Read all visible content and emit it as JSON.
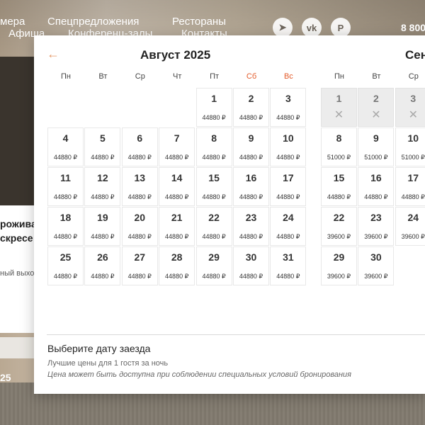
{
  "nav": {
    "links_row1": [
      "мера",
      "Спецпредложения",
      "Рестораны"
    ],
    "links_row2": [
      "Афиша",
      "Конференц-залы",
      "Контакты"
    ],
    "social": [
      {
        "icon": "telegram-icon",
        "glyph": "➤"
      },
      {
        "icon": "vk-icon",
        "glyph": "vk"
      },
      {
        "icon": "pinterest-icon",
        "glyph": "P"
      }
    ],
    "phone": "8 800"
  },
  "left_card": {
    "title_line1": "роживa",
    "title_line2": "скресе",
    "subtitle": "ный выход",
    "year": "25"
  },
  "picker": {
    "prev_icon": "arrow-left-icon",
    "weekdays": [
      "Пн",
      "Вт",
      "Ср",
      "Чт",
      "Пт",
      "Сб",
      "Вс"
    ],
    "month1": {
      "title": "Август 2025",
      "days": [
        {
          "d": "1",
          "p": "44880 ₽"
        },
        {
          "d": "2",
          "p": "44880 ₽"
        },
        {
          "d": "3",
          "p": "44880 ₽"
        },
        {
          "d": "4",
          "p": "44880 ₽"
        },
        {
          "d": "5",
          "p": "44880 ₽"
        },
        {
          "d": "6",
          "p": "44880 ₽"
        },
        {
          "d": "7",
          "p": "44880 ₽"
        },
        {
          "d": "8",
          "p": "44880 ₽"
        },
        {
          "d": "9",
          "p": "44880 ₽"
        },
        {
          "d": "10",
          "p": "44880 ₽"
        },
        {
          "d": "11",
          "p": "44880 ₽"
        },
        {
          "d": "12",
          "p": "44880 ₽"
        },
        {
          "d": "13",
          "p": "44880 ₽"
        },
        {
          "d": "14",
          "p": "44880 ₽"
        },
        {
          "d": "15",
          "p": "44880 ₽"
        },
        {
          "d": "16",
          "p": "44880 ₽"
        },
        {
          "d": "17",
          "p": "44880 ₽"
        },
        {
          "d": "18",
          "p": "44880 ₽"
        },
        {
          "d": "19",
          "p": "44880 ₽"
        },
        {
          "d": "20",
          "p": "44880 ₽"
        },
        {
          "d": "21",
          "p": "44880 ₽"
        },
        {
          "d": "22",
          "p": "44880 ₽"
        },
        {
          "d": "23",
          "p": "44880 ₽"
        },
        {
          "d": "24",
          "p": "44880 ₽"
        },
        {
          "d": "25",
          "p": "44880 ₽"
        },
        {
          "d": "26",
          "p": "44880 ₽"
        },
        {
          "d": "27",
          "p": "44880 ₽"
        },
        {
          "d": "28",
          "p": "44880 ₽"
        },
        {
          "d": "29",
          "p": "44880 ₽"
        },
        {
          "d": "30",
          "p": "44880 ₽"
        },
        {
          "d": "31",
          "p": "44880 ₽"
        }
      ]
    },
    "month2": {
      "title": "Сен",
      "weekdays": [
        "Пн",
        "Вт",
        "Ср"
      ],
      "days": [
        {
          "d": "1",
          "p": "",
          "disabled": true
        },
        {
          "d": "2",
          "p": "",
          "disabled": true
        },
        {
          "d": "3",
          "p": "",
          "disabled": true
        },
        {
          "d": "8",
          "p": "51000 ₽"
        },
        {
          "d": "9",
          "p": "51000 ₽"
        },
        {
          "d": "10",
          "p": "51000 ₽"
        },
        {
          "d": "15",
          "p": "44880 ₽"
        },
        {
          "d": "16",
          "p": "44880 ₽"
        },
        {
          "d": "17",
          "p": "44880 ₽"
        },
        {
          "d": "22",
          "p": "39600 ₽"
        },
        {
          "d": "23",
          "p": "39600 ₽"
        },
        {
          "d": "24",
          "p": "39600 ₽"
        },
        {
          "d": "29",
          "p": "39600 ₽"
        },
        {
          "d": "30",
          "p": "39600 ₽"
        }
      ],
      "unavailable_glyph": "✕"
    },
    "footer": {
      "title": "Выберите дату заезда",
      "subtitle": "Лучшие цены для 1 гостя за ночь",
      "note": "Цена может быть доступна при соблюдении специальных условий бронирования"
    },
    "colors": {
      "weekend": "#e35b2a",
      "arrow": "#e59a6a",
      "disabled": "#ececec"
    }
  }
}
